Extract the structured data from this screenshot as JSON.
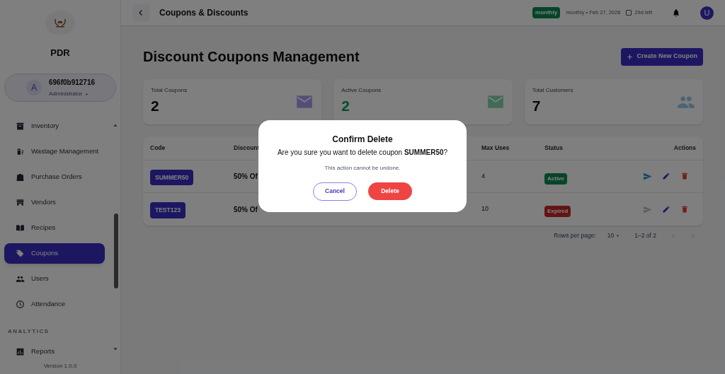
{
  "sidebar": {
    "brand": "PDR",
    "user": {
      "avatar": "A",
      "name": "696f0b912716",
      "role": "Administrator"
    },
    "items": [
      {
        "label": "Inventory",
        "selected": false
      },
      {
        "label": "Wastage Management",
        "selected": false
      },
      {
        "label": "Purchase Orders",
        "selected": false
      },
      {
        "label": "Vendors",
        "selected": false
      },
      {
        "label": "Recipes",
        "selected": false
      },
      {
        "label": "Coupons",
        "selected": true
      },
      {
        "label": "Users",
        "selected": false
      },
      {
        "label": "Attendance",
        "selected": false
      }
    ],
    "section": "ANALYTICS",
    "section_items": [
      {
        "label": "Reports",
        "selected": false
      }
    ],
    "version": "Version 1.0.0"
  },
  "header": {
    "title": "Coupons & Discounts",
    "plan_badge": "monthly",
    "plan_info": "monthly • Feb 27, 2026",
    "days_left": "29d left",
    "avatar": "U"
  },
  "page": {
    "title": "Discount Coupons Management",
    "create_button": "Create New Coupon"
  },
  "stats": [
    {
      "label": "Total Coupons",
      "value": "2"
    },
    {
      "label": "Active Coupons",
      "value": "2"
    },
    {
      "label": "Total Customers",
      "value": "7"
    }
  ],
  "table": {
    "columns": [
      "Code",
      "Discount",
      "Max Uses",
      "Status",
      "Actions"
    ],
    "rows": [
      {
        "code": "SUMMER50",
        "discount": "50% Of",
        "max_uses": "4",
        "status": "Active",
        "active": true,
        "send_enabled": true
      },
      {
        "code": "TEST123",
        "discount": "50% Of",
        "max_uses": "10",
        "status": "Expired",
        "active": false,
        "send_enabled": false
      }
    ],
    "rows_per_page_label": "Rows per page:",
    "rows_per_page": "10",
    "range": "1–2 of 2"
  },
  "dialog": {
    "title": "Confirm Delete",
    "message": "Are you sure you want to delete coupon **SUMMER50**?",
    "note": "This action cannot be undone.",
    "cancel": "Cancel",
    "confirm": "Delete"
  }
}
